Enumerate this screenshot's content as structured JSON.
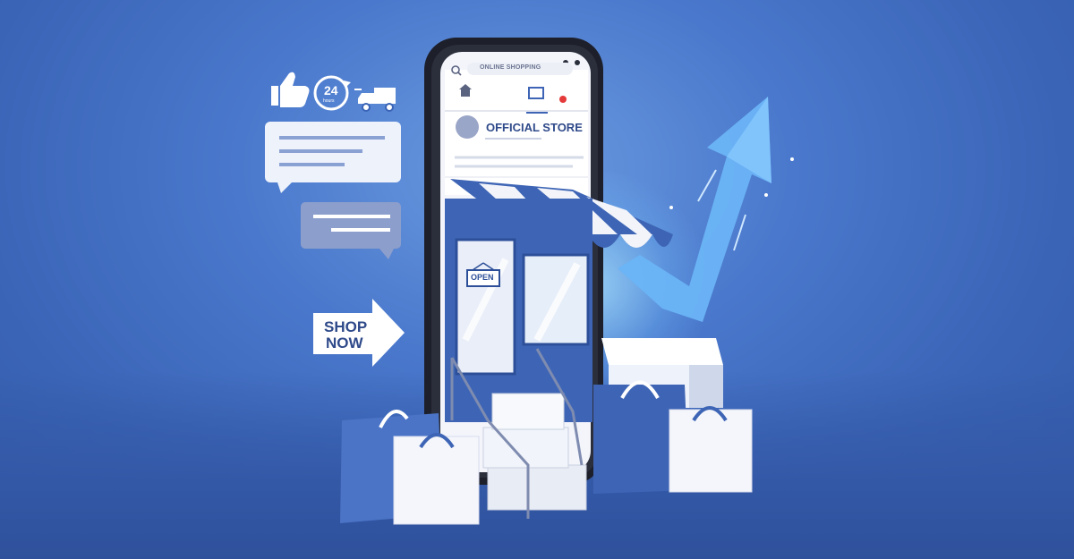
{
  "phone": {
    "search_text": "ONLINE SHOPPING",
    "store_title": "OFFICIAL STORE",
    "door_sign": "OPEN"
  },
  "badges": {
    "hours_label": "24",
    "hours_sub": "hours"
  },
  "shop_now": {
    "line1": "SHOP",
    "line2": "NOW"
  },
  "colors": {
    "background": "#3d67b9",
    "store_blue": "#3e65b5",
    "arrow_blue": "#6ab4f5",
    "white": "#ffffff"
  },
  "icons": [
    "thumbs-up-icon",
    "24-hours-icon",
    "delivery-truck-icon",
    "search-icon",
    "home-icon",
    "store-icon",
    "notification-icon"
  ]
}
